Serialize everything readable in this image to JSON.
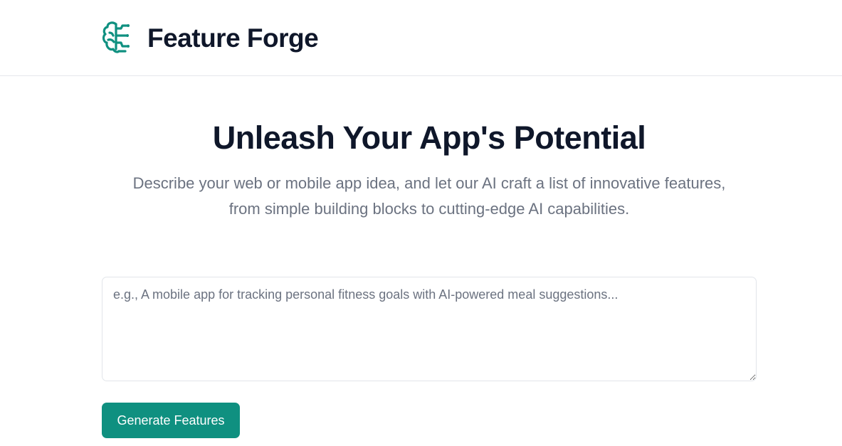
{
  "header": {
    "logo_icon": "brain-circuit-icon",
    "app_title": "Feature Forge",
    "accent_color": "#0f9080"
  },
  "hero": {
    "title": "Unleash Your App's Potential",
    "description": "Describe your web or mobile app idea, and let our AI craft a list of innovative features, from simple building blocks to cutting-edge AI capabilities."
  },
  "form": {
    "idea_placeholder": "e.g., A mobile app for tracking personal fitness goals with AI-powered meal suggestions...",
    "idea_value": "",
    "generate_label": "Generate Features"
  }
}
